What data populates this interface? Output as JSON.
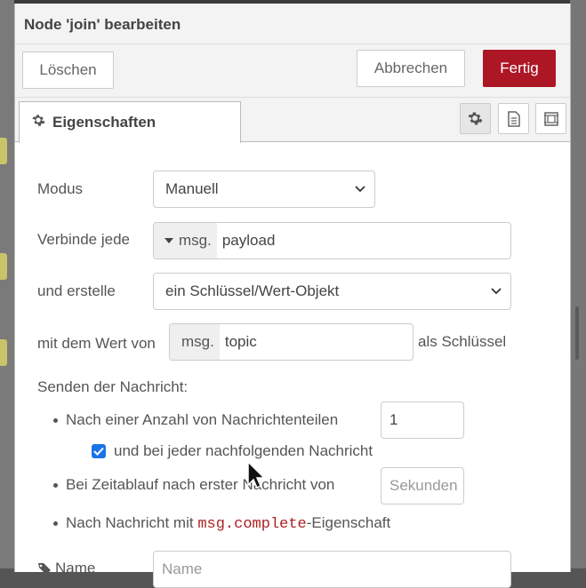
{
  "dialog": {
    "title": "Node 'join' bearbeiten"
  },
  "toolbar": {
    "delete_label": "Löschen",
    "cancel_label": "Abbrechen",
    "done_label": "Fertig"
  },
  "tabs": {
    "properties_label": "Eigenschaften"
  },
  "form": {
    "mode_label": "Modus",
    "mode_value": "Manuell",
    "combine_label": "Verbinde jede",
    "combine_prefix": "msg.",
    "combine_value": "payload",
    "create_label": "und erstelle",
    "create_value": "ein Schlüssel/Wert-Objekt",
    "key_label": "mit dem Wert von",
    "key_prefix": "msg.",
    "key_value": "topic",
    "key_suffix": "als Schlüssel",
    "send_heading": "Senden der Nachricht:",
    "count_label": "Nach einer Anzahl von Nachrichtenteilen",
    "count_value": "1",
    "subsequent_label": "und bei jeder nachfolgenden Nachricht",
    "subsequent_checked": true,
    "timeout_label": "Bei Zeitablauf nach erster Nachricht von",
    "timeout_placeholder": "Sekunden",
    "complete_prefix": "Nach Nachricht mit ",
    "complete_code": "msg.complete",
    "complete_suffix": "-Eigenschaft",
    "name_label": "Name",
    "name_placeholder": "Name"
  },
  "colors": {
    "accent": "#ad1625",
    "checkbox": "#1a73e8"
  }
}
